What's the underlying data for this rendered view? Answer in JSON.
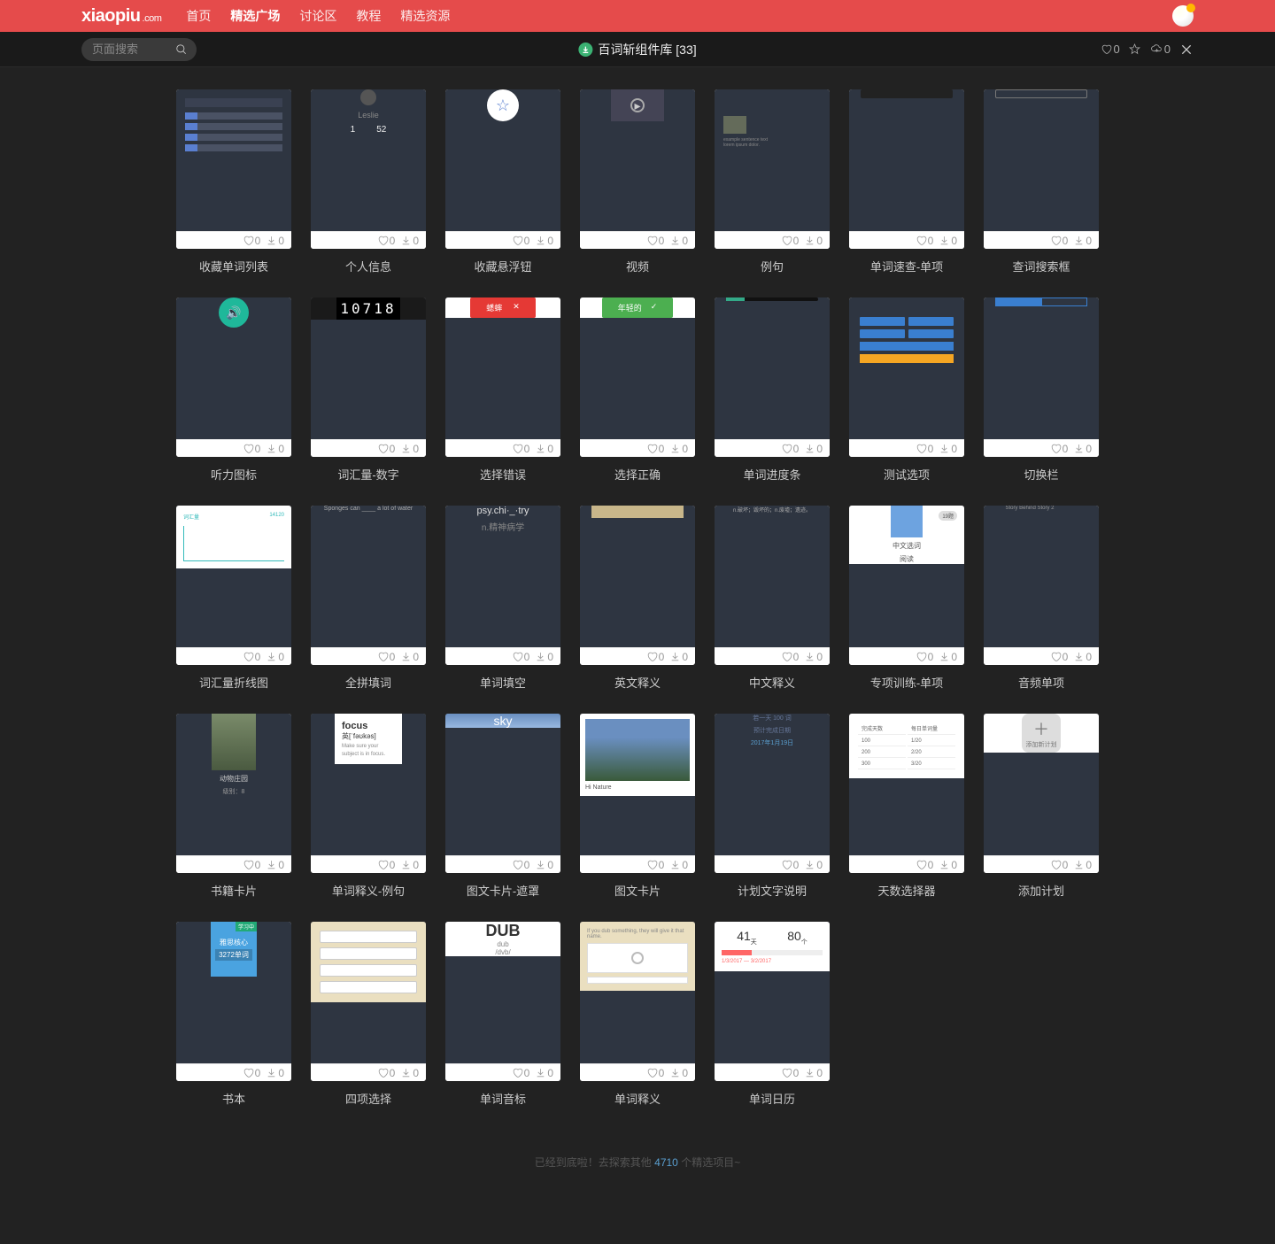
{
  "nav": {
    "logo_main": "xiaopiu",
    "logo_suffix": ".com",
    "items": [
      "首页",
      "精选广场",
      "讨论区",
      "教程",
      "精选资源"
    ],
    "active_index": 1
  },
  "subbar": {
    "search_placeholder": "页面搜索",
    "title": "百词斩组件库 [33]",
    "like_count": 0,
    "star_count": "",
    "download_count": 0
  },
  "cards": [
    {
      "title": "收藏单词列表",
      "like": 0,
      "dl": 0,
      "thumb": "list"
    },
    {
      "title": "个人信息",
      "like": 0,
      "dl": 0,
      "thumb": "profile",
      "profile_name": "Leslie",
      "profile_nums": [
        "1",
        "52"
      ]
    },
    {
      "title": "收藏悬浮钮",
      "like": 0,
      "dl": 0,
      "thumb": "star"
    },
    {
      "title": "视频",
      "like": 0,
      "dl": 0,
      "thumb": "video"
    },
    {
      "title": "例句",
      "like": 0,
      "dl": 0,
      "thumb": "sentence"
    },
    {
      "title": "单词速查-单项",
      "like": 0,
      "dl": 0,
      "thumb": "lookup"
    },
    {
      "title": "查词搜索框",
      "like": 0,
      "dl": 0,
      "thumb": "searchbox"
    },
    {
      "title": "听力图标",
      "like": 0,
      "dl": 0,
      "thumb": "audio"
    },
    {
      "title": "词汇量-数字",
      "like": 0,
      "dl": 0,
      "thumb": "digits",
      "digits": "10718"
    },
    {
      "title": "选择错误",
      "like": 0,
      "dl": 0,
      "thumb": "err",
      "err_text": "蟋蟀"
    },
    {
      "title": "选择正确",
      "like": 0,
      "dl": 0,
      "thumb": "ok",
      "ok_text": "年轻的"
    },
    {
      "title": "单词进度条",
      "like": 0,
      "dl": 0,
      "thumb": "prog"
    },
    {
      "title": "测试选项",
      "like": 0,
      "dl": 0,
      "thumb": "opts"
    },
    {
      "title": "切换栏",
      "like": 0,
      "dl": 0,
      "thumb": "switch"
    },
    {
      "title": "词汇量折线图",
      "like": 0,
      "dl": 0,
      "thumb": "chart",
      "chart_hdr_l": "词汇量",
      "chart_hdr_r": "14120"
    },
    {
      "title": "全拼填词",
      "like": 0,
      "dl": 0,
      "thumb": "cloze",
      "cloze_text": "Sponges can ____ a lot of water"
    },
    {
      "title": "单词填空",
      "like": 0,
      "dl": 0,
      "thumb": "blank",
      "blank_word": "psy.chi·_·try"
    },
    {
      "title": "英文释义",
      "like": 0,
      "dl": 0,
      "thumb": "def"
    },
    {
      "title": "中文释义",
      "like": 0,
      "dl": 0,
      "thumb": "def2",
      "def2_text": "n.破坏；毁坏的；n.废墟；遗迹。"
    },
    {
      "title": "专项训练-单项",
      "like": 0,
      "dl": 0,
      "thumb": "train",
      "train_l1": "中文选词",
      "train_l2": "阅读",
      "train_tag": "19题"
    },
    {
      "title": "音频单项",
      "like": 0,
      "dl": 0,
      "thumb": "aq"
    },
    {
      "title": "书籍卡片",
      "like": 0,
      "dl": 0,
      "thumb": "book",
      "book_l1": "动物庄园",
      "book_l2": "级别：8"
    },
    {
      "title": "单词释义-例句",
      "like": 0,
      "dl": 0,
      "thumb": "focus",
      "focus_word": "focus"
    },
    {
      "title": "图文卡片-遮罩",
      "like": 0,
      "dl": 0,
      "thumb": "sky",
      "sky_text": "sky"
    },
    {
      "title": "图文卡片",
      "like": 0,
      "dl": 0,
      "thumb": "nature",
      "nature_cap": "Hi Nature"
    },
    {
      "title": "计划文字说明",
      "like": 0,
      "dl": 0,
      "thumb": "plan",
      "plan_date": "2017年1月19日"
    },
    {
      "title": "天数选择器",
      "like": 0,
      "dl": 0,
      "thumb": "days"
    },
    {
      "title": "添加计划",
      "like": 0,
      "dl": 0,
      "thumb": "add",
      "add_text": "添加新计划"
    },
    {
      "title": "书本",
      "like": 0,
      "dl": 0,
      "thumb": "booklet",
      "bk_l1": "雅思核心",
      "bk_l2": "3272单词"
    },
    {
      "title": "四项选择",
      "like": 0,
      "dl": 0,
      "thumb": "4opt"
    },
    {
      "title": "单词音标",
      "like": 0,
      "dl": 0,
      "thumb": "dub",
      "dub_word": "DUB",
      "dub_p1": "dub",
      "dub_p2": "/dvb/"
    },
    {
      "title": "单词释义",
      "like": 0,
      "dl": 0,
      "thumb": "worddef"
    },
    {
      "title": "单词日历",
      "like": 0,
      "dl": 0,
      "thumb": "cal",
      "cal_a": "41",
      "cal_b": "80"
    }
  ],
  "footer": {
    "pre": "已经到底啦！去探索其他",
    "count": "4710",
    "post": "个精选项目~"
  }
}
